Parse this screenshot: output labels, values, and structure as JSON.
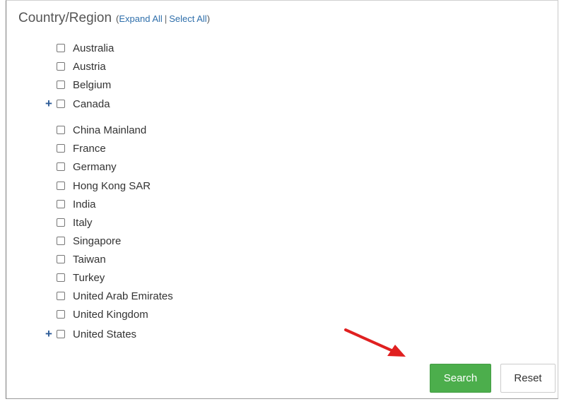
{
  "section": {
    "title": "Country/Region",
    "open_paren": "(",
    "expand_all": "Expand All",
    "separator": "|",
    "select_all": "Select All",
    "close_paren": ")"
  },
  "countries": [
    {
      "label": "Australia",
      "expandable": false,
      "checked": false
    },
    {
      "label": "Austria",
      "expandable": false,
      "checked": false
    },
    {
      "label": "Belgium",
      "expandable": false,
      "checked": false
    },
    {
      "label": "Canada",
      "expandable": true,
      "checked": false
    },
    {
      "label": "China Mainland",
      "expandable": false,
      "checked": false
    },
    {
      "label": "France",
      "expandable": false,
      "checked": false
    },
    {
      "label": "Germany",
      "expandable": false,
      "checked": false
    },
    {
      "label": "Hong Kong SAR",
      "expandable": false,
      "checked": false
    },
    {
      "label": "India",
      "expandable": false,
      "checked": false
    },
    {
      "label": "Italy",
      "expandable": false,
      "checked": false
    },
    {
      "label": "Singapore",
      "expandable": false,
      "checked": false
    },
    {
      "label": "Taiwan",
      "expandable": false,
      "checked": false
    },
    {
      "label": "Turkey",
      "expandable": false,
      "checked": false
    },
    {
      "label": "United Arab Emirates",
      "expandable": false,
      "checked": false
    },
    {
      "label": "United Kingdom",
      "expandable": false,
      "checked": false
    },
    {
      "label": "United States",
      "expandable": true,
      "checked": false
    }
  ],
  "expand_glyph": "+",
  "buttons": {
    "search": "Search",
    "reset": "Reset"
  },
  "colors": {
    "link": "#2f6fab",
    "search_button": "#4cae4c",
    "annotation_arrow": "#e02020",
    "expand_icon": "#2b5a96"
  }
}
